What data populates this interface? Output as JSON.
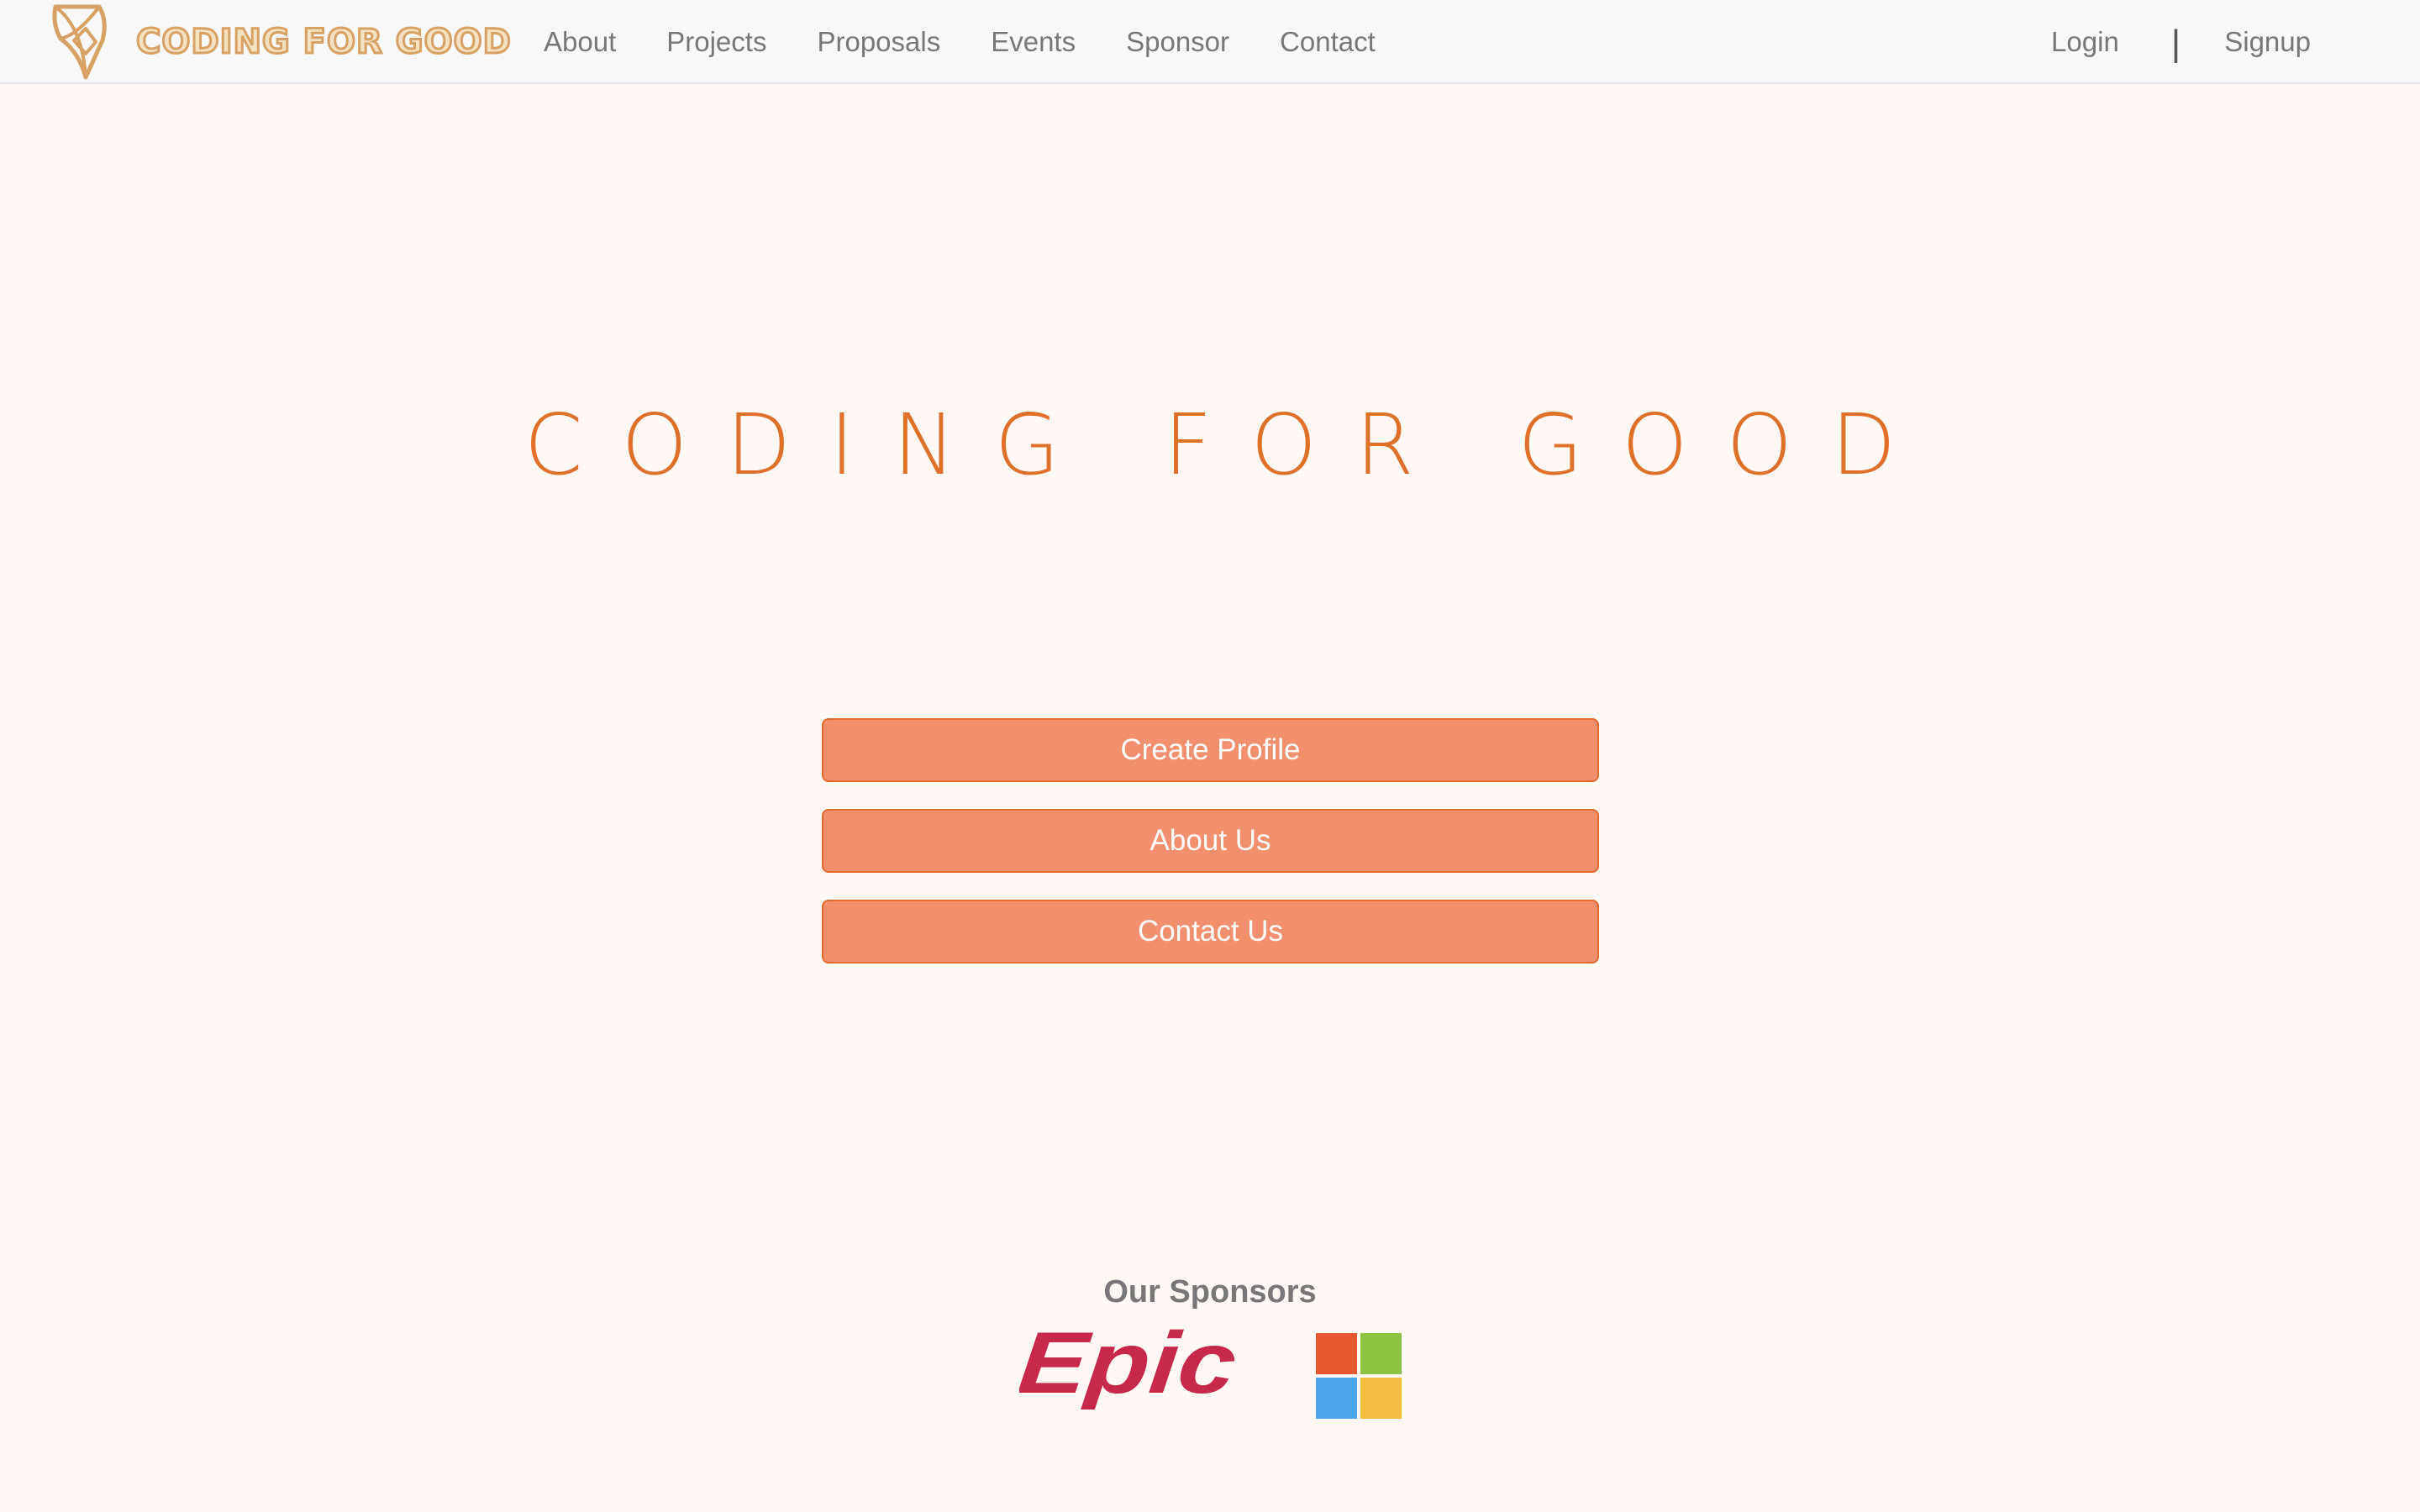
{
  "navbar": {
    "brand_name": "CODING FOR GOOD",
    "links": [
      {
        "label": "About"
      },
      {
        "label": "Projects"
      },
      {
        "label": "Proposals"
      },
      {
        "label": "Events"
      },
      {
        "label": "Sponsor"
      },
      {
        "label": "Contact"
      }
    ],
    "login_label": "Login",
    "separator": "|",
    "signup_label": "Signup"
  },
  "hero": {
    "title": "CODING FOR GOOD"
  },
  "actions": {
    "create_profile": "Create Profile",
    "about_us": "About Us",
    "contact_us": "Contact Us"
  },
  "sponsors": {
    "title": "Our Sponsors",
    "logos": [
      {
        "name": "Epic",
        "icon": "epic-logo-icon",
        "color": "#c8294a"
      },
      {
        "name": "Microsoft",
        "icon": "microsoft-logo-icon",
        "colors": [
          "#e8582e",
          "#8bc53f",
          "#4aa6e9",
          "#f4be41"
        ]
      }
    ]
  },
  "colors": {
    "page_background": "#fff8f5",
    "navbar_background": "#f8f8f8",
    "accent": "#e06f28",
    "button_fill": "#f28f6d",
    "button_border": "#e2692a",
    "nav_text": "#777777",
    "brand_logo": "#d9a064"
  }
}
